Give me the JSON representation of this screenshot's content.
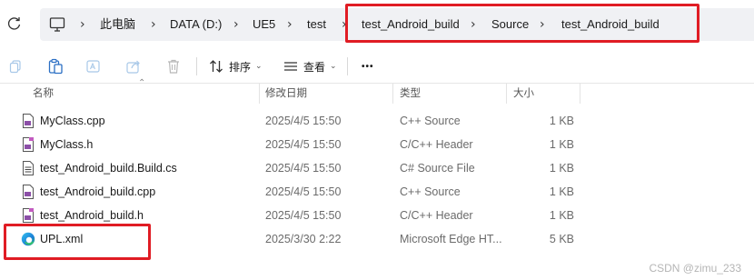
{
  "address_bar": {
    "path": [
      "此电脑",
      "DATA (D:)",
      "UE5",
      "test",
      "test_Android_build",
      "Source",
      "test_Android_build"
    ]
  },
  "toolbar": {
    "sort_label": "排序",
    "view_label": "查看",
    "more_label": "•••"
  },
  "columns": {
    "name": "名称",
    "date": "修改日期",
    "type": "类型",
    "size": "大小"
  },
  "files": [
    {
      "name": "MyClass.cpp",
      "date": "2025/4/5 15:50",
      "type": "C++ Source",
      "size": "1 KB",
      "icon": "cpp-file-icon"
    },
    {
      "name": "MyClass.h",
      "date": "2025/4/5 15:50",
      "type": "C/C++ Header",
      "size": "1 KB",
      "icon": "header-file-icon"
    },
    {
      "name": "test_Android_build.Build.cs",
      "date": "2025/4/5 15:50",
      "type": "C# Source File",
      "size": "1 KB",
      "icon": "cs-file-icon"
    },
    {
      "name": "test_Android_build.cpp",
      "date": "2025/4/5 15:50",
      "type": "C++ Source",
      "size": "1 KB",
      "icon": "cpp-file-icon"
    },
    {
      "name": "test_Android_build.h",
      "date": "2025/4/5 15:50",
      "type": "C/C++ Header",
      "size": "1 KB",
      "icon": "header-file-icon"
    },
    {
      "name": "UPL.xml",
      "date": "2025/3/30 2:22",
      "type": "Microsoft Edge HT...",
      "size": "5 KB",
      "icon": "edge-icon"
    }
  ],
  "watermark": "CSDN @zimu_233",
  "colors": {
    "highlight_box": "#e01c24",
    "address_bg": "#f0f1f4"
  }
}
